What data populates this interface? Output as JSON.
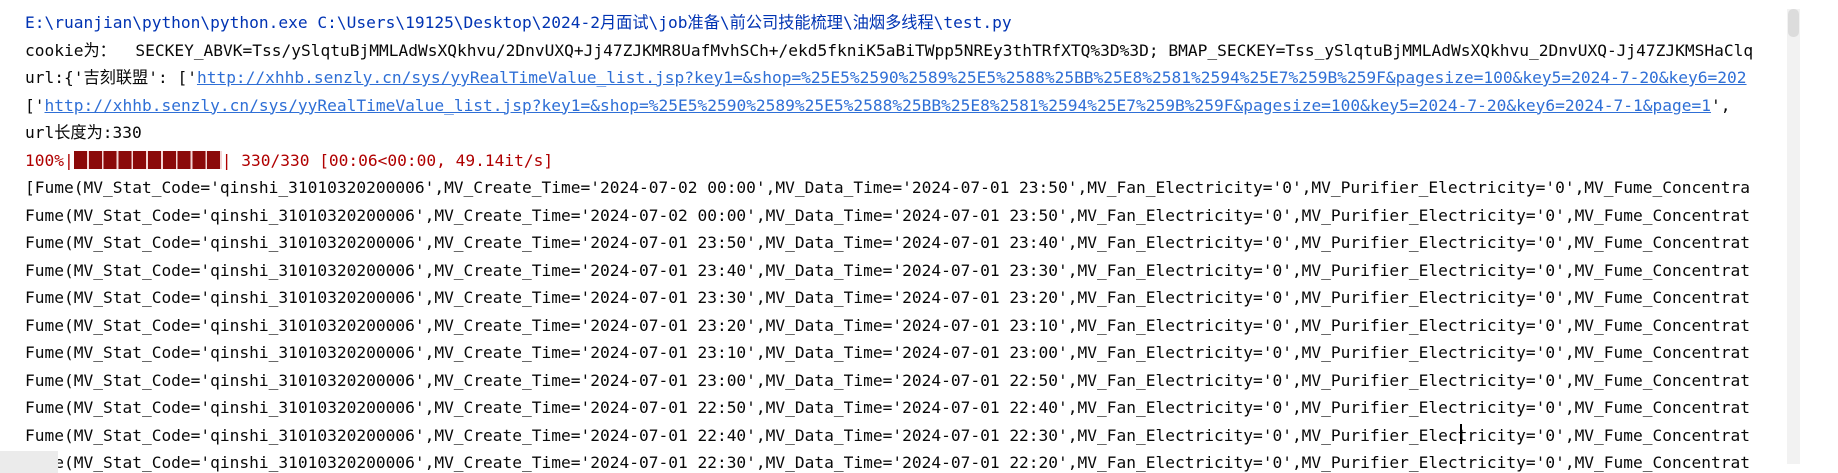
{
  "console": {
    "command_line": "E:\\ruanjian\\python\\python.exe C:\\Users\\19125\\Desktop\\2024-2月面试\\job准备\\前公司技能梳理\\油烟多线程\\test.py",
    "cookie_line": "cookie为：  SECKEY_ABVK=Tss/ySlqtuBjMMLAdWsXQkhvu/2DnvUXQ+Jj47ZJKMR8UafMvhSCh+/ekd5fkniK5aBiTWpp5NREy3thTRfXTQ%3D%3D; BMAP_SECKEY=Tss_ySlqtuBjMMLAdWsXQkhvu_2DnvUXQ-Jj47ZJKMSHaClq",
    "url_prefix": "url:{'吉刻联盟': ['",
    "url_link": "http://xhhb.senzly.cn/sys/yyRealTimeValue_list.jsp?key1=&shop=%25E5%2590%2589%25E5%2588%25BB%25E8%2581%2594%25E7%259B%259F&pagesize=100&key5=2024-7-20&key6=202",
    "list_prefix": "['",
    "list_link": "http://xhhb.senzly.cn/sys/yyRealTimeValue_list.jsp?key1=&shop=%25E5%2590%2589%25E5%2588%25BB%25E8%2581%2594%25E7%259B%259F&pagesize=100&key5=2024-7-20&key6=2024-7-1&page=1",
    "list_suffix": "',",
    "url_length_line": "url长度为:330",
    "progress_prefix": "100%|",
    "progress_value": 1.0,
    "progress_suffix": "| 330/330 [00:06<00:00, 49.14it/s]",
    "fume_rows": [
      "[Fume(MV_Stat_Code='qinshi_31010320200006',MV_Create_Time='2024-07-02 00:00',MV_Data_Time='2024-07-01 23:50',MV_Fan_Electricity='0',MV_Purifier_Electricity='0',MV_Fume_Concentra",
      "Fume(MV_Stat_Code='qinshi_31010320200006',MV_Create_Time='2024-07-02 00:00',MV_Data_Time='2024-07-01 23:50',MV_Fan_Electricity='0',MV_Purifier_Electricity='0',MV_Fume_Concentrat",
      "Fume(MV_Stat_Code='qinshi_31010320200006',MV_Create_Time='2024-07-01 23:50',MV_Data_Time='2024-07-01 23:40',MV_Fan_Electricity='0',MV_Purifier_Electricity='0',MV_Fume_Concentrat",
      "Fume(MV_Stat_Code='qinshi_31010320200006',MV_Create_Time='2024-07-01 23:40',MV_Data_Time='2024-07-01 23:30',MV_Fan_Electricity='0',MV_Purifier_Electricity='0',MV_Fume_Concentrat",
      "Fume(MV_Stat_Code='qinshi_31010320200006',MV_Create_Time='2024-07-01 23:30',MV_Data_Time='2024-07-01 23:20',MV_Fan_Electricity='0',MV_Purifier_Electricity='0',MV_Fume_Concentrat",
      "Fume(MV_Stat_Code='qinshi_31010320200006',MV_Create_Time='2024-07-01 23:20',MV_Data_Time='2024-07-01 23:10',MV_Fan_Electricity='0',MV_Purifier_Electricity='0',MV_Fume_Concentrat",
      "Fume(MV_Stat_Code='qinshi_31010320200006',MV_Create_Time='2024-07-01 23:10',MV_Data_Time='2024-07-01 23:00',MV_Fan_Electricity='0',MV_Purifier_Electricity='0',MV_Fume_Concentrat",
      "Fume(MV_Stat_Code='qinshi_31010320200006',MV_Create_Time='2024-07-01 23:00',MV_Data_Time='2024-07-01 22:50',MV_Fan_Electricity='0',MV_Purifier_Electricity='0',MV_Fume_Concentrat",
      "Fume(MV_Stat_Code='qinshi_31010320200006',MV_Create_Time='2024-07-01 22:50',MV_Data_Time='2024-07-01 22:40',MV_Fan_Electricity='0',MV_Purifier_Electricity='0',MV_Fume_Concentrat",
      "Fume(MV_Stat_Code='qinshi_31010320200006',MV_Create_Time='2024-07-01 22:40',MV_Data_Time='2024-07-01 22:30',MV_Fan_Electricity='0',MV_Purifier_Electricity='0',MV_Fume_Concentrat",
      "Fume(MV_Stat_Code='qinshi_31010320200006',MV_Create_Time='2024-07-01 22:30',MV_Data_Time='2024-07-01 22:20',MV_Fan_Electricity='0',MV_Purifier_Electricity='0',MV_Fume_Concentrat"
    ]
  },
  "colors": {
    "command": "#0033b3",
    "text": "#080808",
    "link": "#2f6fd6",
    "stderr": "#b00000",
    "progress_fill": "#8b0a0a"
  }
}
